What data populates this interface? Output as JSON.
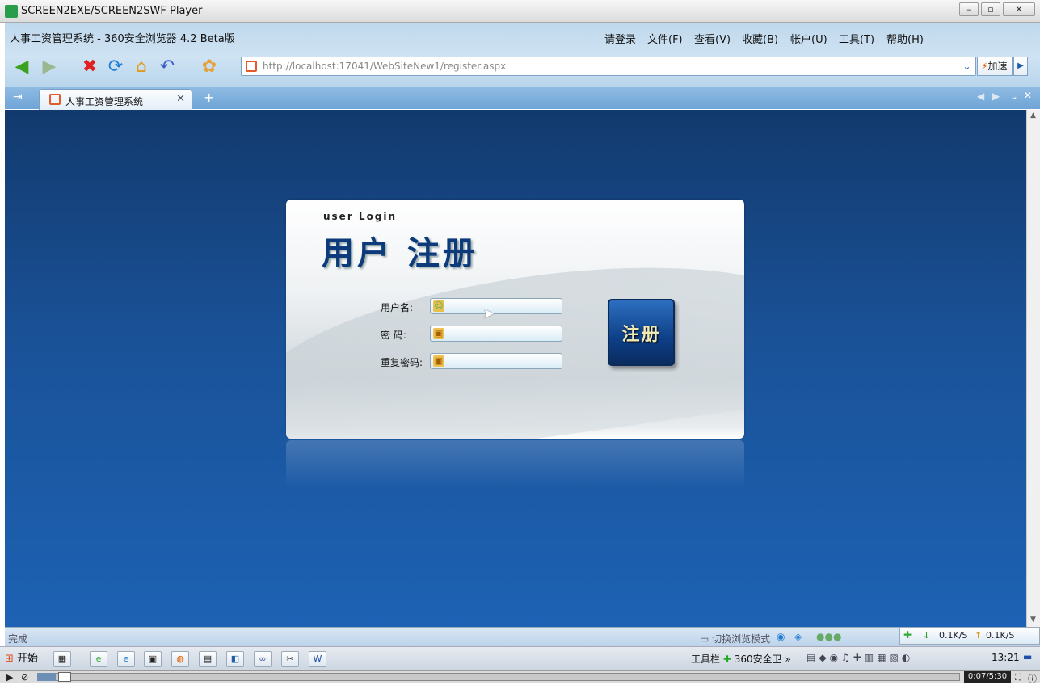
{
  "player": {
    "title": "SCREEN2EXE/SCREEN2SWF Player",
    "time": "0:07/5:30",
    "progress_fraction": 0.02
  },
  "browser": {
    "title": "人事工资管理系统 - 360安全浏览器 4.2 Beta版",
    "menu": [
      "请登录",
      "文件(F)",
      "查看(V)",
      "收藏(B)",
      "帐户(U)",
      "工具(T)",
      "帮助(H)"
    ],
    "address": "http://localhost:17041/WebSiteNew1/register.aspx",
    "speed_label": "加速",
    "tab_label": "人事工资管理系统",
    "status_text": "完成",
    "mode_label": "切换浏览模式",
    "down_speed": "0.1K/S",
    "up_speed": "0.1K/S"
  },
  "page": {
    "login_caption": "user Login",
    "title": "用户 注册",
    "username_label": "用户名:",
    "password_label": "密  码:",
    "repeat_label": "重复密码:",
    "register_button": "注册"
  },
  "taskbar": {
    "start_label": "开始",
    "toolbar_label": "工具栏",
    "guard_label": "360安全卫",
    "clock": "13:21"
  }
}
